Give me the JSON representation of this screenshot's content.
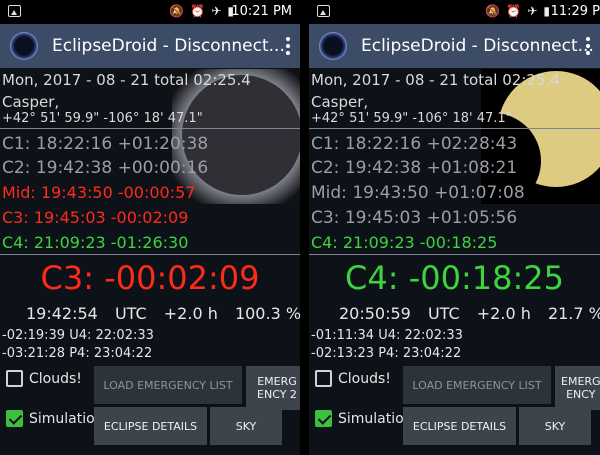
{
  "status_bar": {
    "icons": [
      "mute-icon",
      "alarm-icon",
      "airplane-icon",
      "battery-icon"
    ]
  },
  "left": {
    "status_time": "10:21 PM",
    "app_title": "EclipseDroid - Disconnect...",
    "date_line": "Mon, 2017 - 08 - 21  total  02:25.4",
    "location": "Casper,",
    "coords": "+42° 51' 59.9\"  -106° 18' 47.1\"",
    "c1": "C1: 18:22:16  +01:20:38",
    "c2": "C2: 19:42:38  +00:00:16",
    "mid": "Mid:  19:43:50  -00:00:57",
    "c3": "C3:  19:45:03  -00:02:09",
    "c4": "C4:  21:09:23  -01:26:30",
    "countdown": "C3: -00:02:09",
    "clock": "19:42:54",
    "utc": "UTC",
    "offset": "+2.0 h",
    "percent": "100.3 %",
    "line_a": "-02:19:39  U4: 22:02:33",
    "line_b": "-03:21:28  P4: 23:04:22",
    "clouds_label": "Clouds!",
    "simulation_label": "Simulation",
    "load_btn": "LOAD EMERGENCY LIST",
    "emergency_btn": "EMERG ENCY 2",
    "details_btn": "ECLIPSE DETAILS",
    "sky_btn": "SKY"
  },
  "right": {
    "status_time": "11:29 P",
    "app_title": "EclipseDroid - Disconnect...",
    "date_line": "Mon, 2017 - 08 - 21  total  02:25.4",
    "location": "Casper,",
    "coords": "+42° 51' 59.9\"  -106° 18' 47.1\"",
    "c1": "C1: 18:22:16  +02:28:43",
    "c2": "C2: 19:42:38  +01:08:21",
    "mid": "Mid:  19:43:50  +01:07:08",
    "c3": "C3:  19:45:03  +01:05:56",
    "c4": "C4:  21:09:23  -00:18:25",
    "countdown": "C4: -00:18:25",
    "clock": "20:50:59",
    "utc": "UTC",
    "offset": "+2.0 h",
    "percent": "21.7 %",
    "line_a": "-01:11:34  U4: 22:02:33",
    "line_b": "-02:13:23  P4: 23:04:22",
    "clouds_label": "Clouds!",
    "simulation_label": "Simulation",
    "load_btn": "LOAD EMERGENCY LIST",
    "emergency_btn": "EMERG ENCY",
    "details_btn": "ECLIPSE DETAILS",
    "sky_btn": "SKY"
  },
  "colors": {
    "appbar": "#3c4b66",
    "red_text": "#ff2a1a",
    "green_text": "#3ed43e",
    "sun": "#dccb80"
  }
}
